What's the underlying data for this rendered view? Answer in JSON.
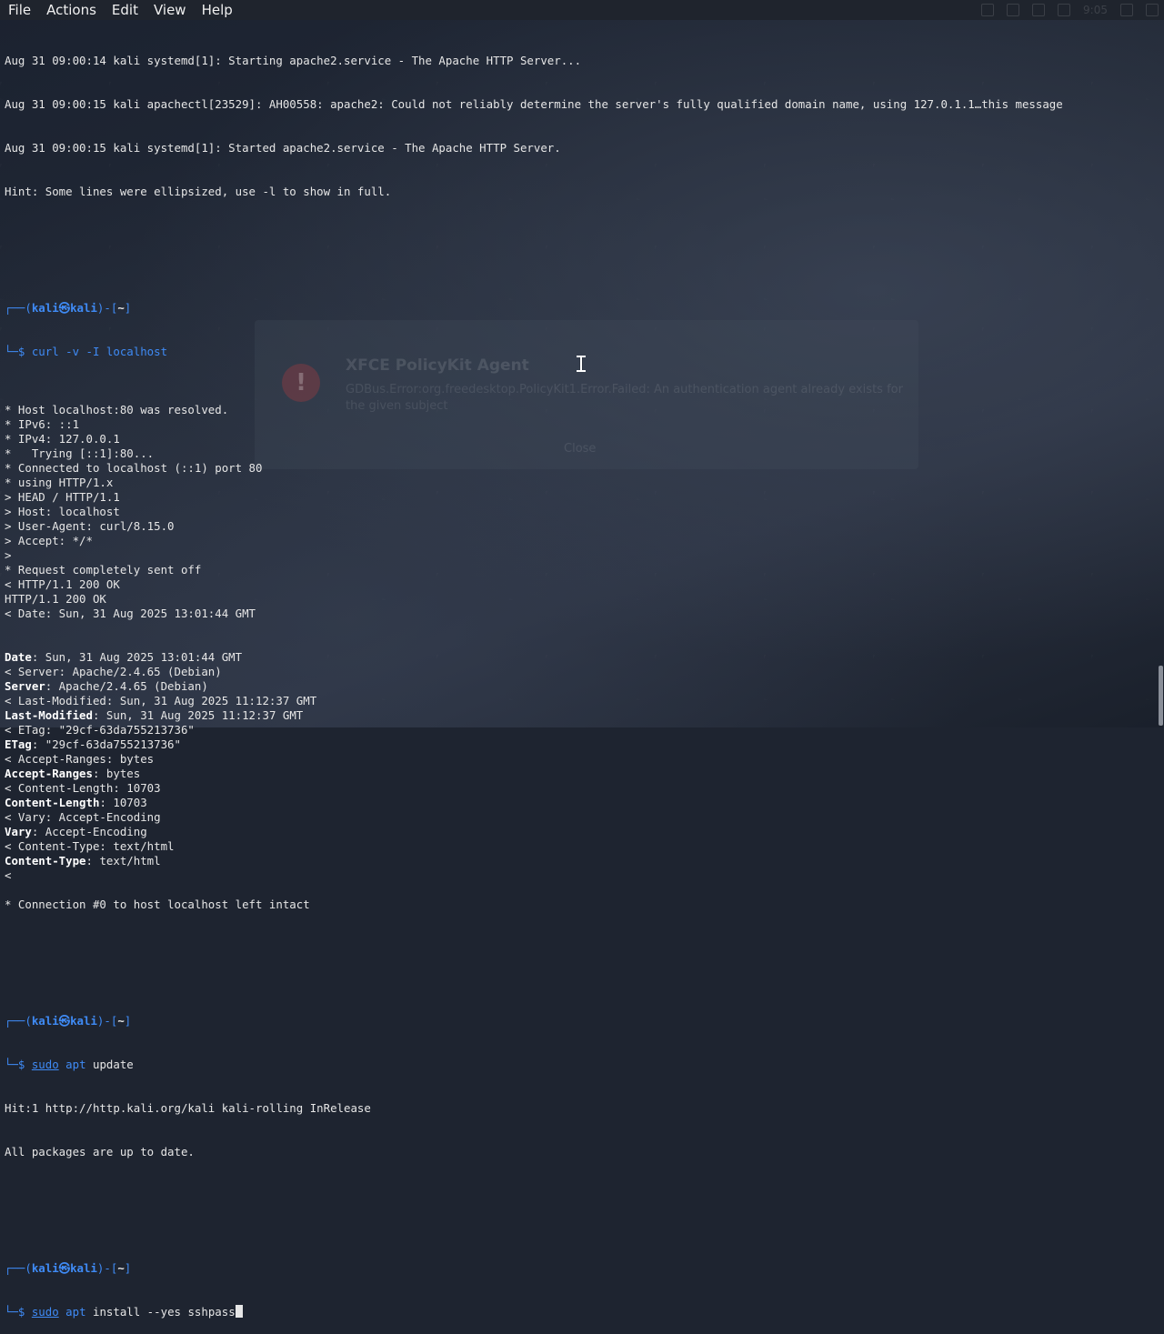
{
  "menubar": {
    "items": [
      "File",
      "Actions",
      "Edit",
      "View",
      "Help"
    ]
  },
  "tray": {
    "clock": "9:05"
  },
  "notification": {
    "title": "XFCE PolicyKit Agent",
    "body": "GDBus.Error:org.freedesktop.PolicyKit1.Error.Failed: An authentication agent already exists for the given subject",
    "close_label": "Close"
  },
  "terminal": {
    "lines": [
      "Aug 31 09:00:14 kali systemd[1]: Starting apache2.service - The Apache HTTP Server...",
      "Aug 31 09:00:15 kali apachectl[23529]: AH00558: apache2: Could not reliably determine the server's fully qualified domain name, using 127.0.1.1…this message",
      "Aug 31 09:00:15 kali systemd[1]: Started apache2.service - The Apache HTTP Server.",
      "Hint: Some lines were ellipsized, use -l to show in full."
    ],
    "prompt": {
      "top_open": "┌──(",
      "user": "kali㉿kali",
      "top_mid": ")-[",
      "dir": "~",
      "top_close": "]",
      "bottom": "└─$ "
    },
    "cmd1": "curl -v -I localhost",
    "curl_output": [
      "* Host localhost:80 was resolved.",
      "* IPv6: ::1",
      "* IPv4: 127.0.0.1",
      "*   Trying [::1]:80...",
      "* Connected to localhost (::1) port 80",
      "* using HTTP/1.x",
      "> HEAD / HTTP/1.1",
      "> Host: localhost",
      "> User-Agent: curl/8.15.0",
      "> Accept: */*",
      ">",
      "* Request completely sent off",
      "< HTTP/1.1 200 OK",
      "HTTP/1.1 200 OK",
      "< Date: Sun, 31 Aug 2025 13:01:44 GMT"
    ],
    "headers": [
      {
        "name": "Date",
        "value": ": Sun, 31 Aug 2025 13:01:44 GMT"
      },
      {
        "raw": "< Server: Apache/2.4.65 (Debian)"
      },
      {
        "name": "Server",
        "value": ": Apache/2.4.65 (Debian)"
      },
      {
        "raw": "< Last-Modified: Sun, 31 Aug 2025 11:12:37 GMT"
      },
      {
        "name": "Last-Modified",
        "value": ": Sun, 31 Aug 2025 11:12:37 GMT"
      },
      {
        "raw": "< ETag: \"29cf-63da755213736\""
      },
      {
        "name": "ETag",
        "value": ": \"29cf-63da755213736\""
      },
      {
        "raw": "< Accept-Ranges: bytes"
      },
      {
        "name": "Accept-Ranges",
        "value": ": bytes"
      },
      {
        "raw": "< Content-Length: 10703"
      },
      {
        "name": "Content-Length",
        "value": ": 10703"
      },
      {
        "raw": "< Vary: Accept-Encoding"
      },
      {
        "name": "Vary",
        "value": ": Accept-Encoding"
      },
      {
        "raw": "< Content-Type: text/html"
      },
      {
        "name": "Content-Type",
        "value": ": text/html"
      },
      {
        "raw": "<"
      },
      {
        "raw": ""
      },
      {
        "raw": "* Connection #0 to host localhost left intact"
      }
    ],
    "cmd2_sudo": "sudo",
    "cmd2_apt": "apt",
    "cmd2_rest": " update",
    "apt_output": [
      "Hit:1 http://http.kali.org/kali kali-rolling InRelease",
      "All packages are up to date."
    ],
    "cmd3_sudo": "sudo",
    "cmd3_apt": "apt",
    "cmd3_rest": " install --yes sshpass"
  }
}
